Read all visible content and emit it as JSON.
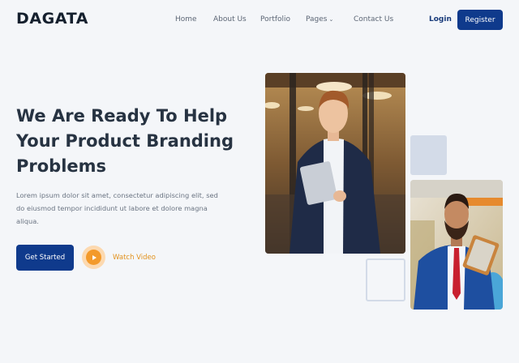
{
  "header": {
    "logo": "DAGATA",
    "nav": [
      {
        "label": "Home"
      },
      {
        "label": "About Us"
      },
      {
        "label": "Portfolio"
      },
      {
        "label": "Pages",
        "has_dropdown": true
      },
      {
        "label": "Contact Us"
      }
    ],
    "login_label": "Login",
    "register_label": "Register"
  },
  "hero": {
    "title_lines": [
      "We Are Ready To Help",
      "Your Product Branding",
      "Problems"
    ],
    "description_lines": [
      "Lorem ipsum dolor sit amet, consectetur adipiscing elit, sed",
      "do eiusmod tempor incididunt ut labore et dolore magna",
      "aliqua."
    ],
    "primary_button": "Get Started",
    "video_link": "Watch Video"
  },
  "images": [
    {
      "subject": "man-holding-laptop-photo"
    },
    {
      "subject": "man-with-tablet-photo"
    }
  ],
  "colors": {
    "primary": "#0f3a8c",
    "accent": "#f39a2b",
    "background": "#f4f6f9",
    "deco": "#d3dbe8"
  }
}
